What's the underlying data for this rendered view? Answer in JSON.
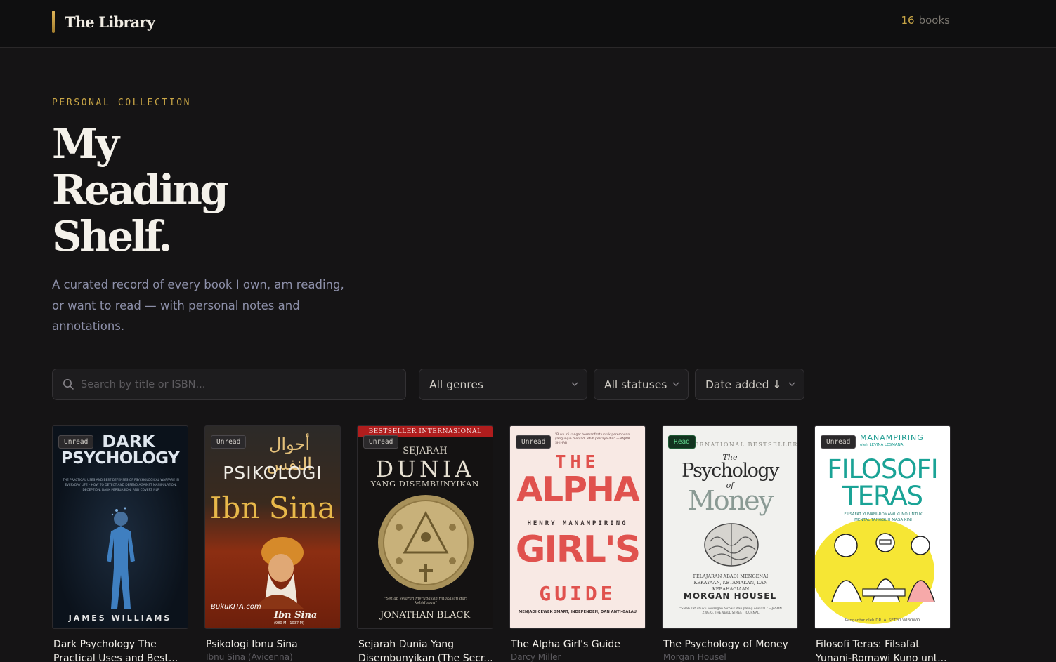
{
  "header": {
    "brand": "The Library",
    "book_count": "16",
    "book_count_unit": "books"
  },
  "hero": {
    "eyebrow": "PERSONAL COLLECTION",
    "title_line1": "My",
    "title_line2": "Reading",
    "title_line3": "Shelf.",
    "description": "A curated record of every book I own, am reading, or want to read — with personal notes and annotations."
  },
  "filters": {
    "search_placeholder": "Search by title or ISBN...",
    "genre": "All genres",
    "status": "All statuses",
    "sort": "Date added ↓"
  },
  "books": [
    {
      "title_line1": "Dark Psychology The",
      "title_line2": "Practical Uses and Best...",
      "author": "",
      "status": "Unread",
      "cover": {
        "title1": "DARK",
        "title2": "PSYCHOLOGY",
        "sub": "THE PRACTICAL USES AND BEST DEFENSES OF PSYCHOLOGICAL WARFARE IN EVERYDAY LIFE – HOW TO DETECT AND DEFEND AGAINST MANIPULATION, DECEPTION, DARK PERSUASION, AND COVERT NLP",
        "author": "JAMES WILLIAMS"
      }
    },
    {
      "title_line1": "Psikologi Ibnu Sina",
      "title_line2": "",
      "author": "Ibnu Sina (Avicenna)",
      "status": "Unread",
      "cover": {
        "arabic": "أحوال النفس",
        "title1": "PSIKOLOGI",
        "title2": "Ibn Sina",
        "watermark": "BukuKITA.com",
        "sig": "Ibn Sina",
        "years": "(980 M - 1037 M)"
      }
    },
    {
      "title_line1": "Sejarah Dunia Yang",
      "title_line2": "Disembunyikan (The Secr...",
      "author": "",
      "status": "Unread",
      "cover": {
        "banner": "BESTSELLER INTERNASIONAL",
        "top": "SEJARAH",
        "title": "DUNIA",
        "sub": "YANG DISEMBUNYIKAN",
        "quote": "\"Setiap sejarah merupakan ringkasan dari kehidupan\"",
        "author": "JONATHAN BLACK"
      }
    },
    {
      "title_line1": "The Alpha Girl's Guide",
      "title_line2": "",
      "author": "Darcy Miller",
      "status": "Unread",
      "cover": {
        "quote": "\"Buku ini sangat bermanfaat untuk perempuan yang ingin menjadi lebih percaya diri\" —NAJWA SHIHAB",
        "the": "THE",
        "alpha": "ALPHA",
        "author": "HENRY MANAMPIRING",
        "girls": "GIRL'S",
        "guide": "GUIDE",
        "tagline": "MENJADI CEWEK SMART, INDEPENDEN, DAN ANTI-GALAU"
      }
    },
    {
      "title_line1": "The Psychology of Money",
      "title_line2": "",
      "author": "Morgan Housel",
      "status": "Read",
      "cover": {
        "banner": "INTERNATIONAL BESTSELLER",
        "the": "The",
        "title1": "Psychology",
        "of": "of",
        "title2": "Money",
        "sub": "PELAJARAN ABADI MENGENAI KEKAYAAN, KETAMAKAN, DAN KEBAHAGIAAN",
        "author": "MORGAN HOUSEL",
        "quote": "\"Salah satu buku keuangan terbaik dan paling orisinal.\" —JASON ZWEIG, THE WALL STREET JOURNAL"
      }
    },
    {
      "title_line1": "Filosofi Teras: Filsafat",
      "title_line2": "Yunani-Romawi Kuno unt...",
      "author": "",
      "status": "Unread",
      "cover": {
        "author": "MANAMPIRING",
        "author_sub": "oleh LEVINA LESMANA",
        "title1": "FILOSOFI",
        "title2": "TERAS",
        "sub": "FILSAFAT YUNANI-ROMAWI KUNO UNTUK MENTAL TANGGUH MASA KINI",
        "foot": "Pengantar oleh DR. A. SETYO WIBOWO"
      }
    }
  ]
}
